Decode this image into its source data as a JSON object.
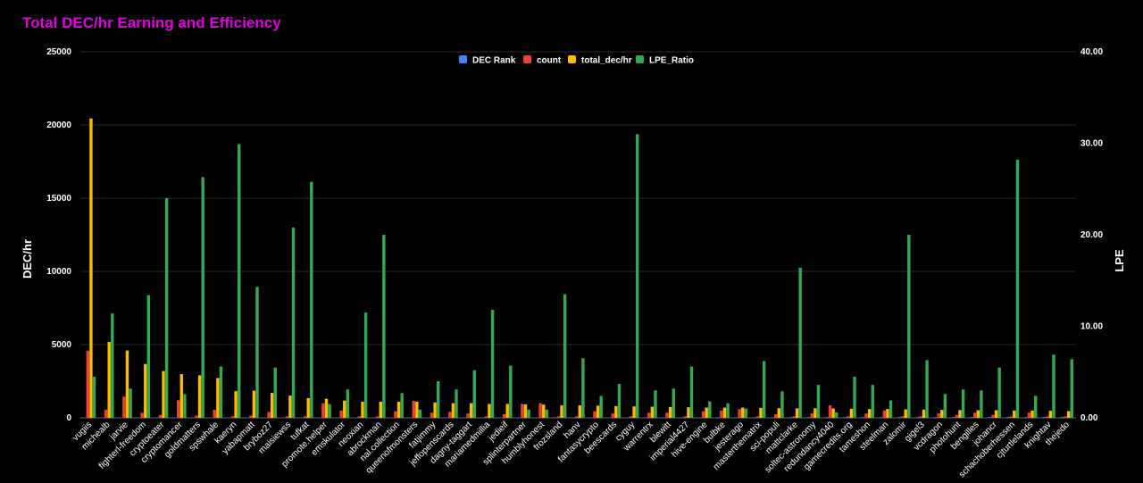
{
  "chart_data": {
    "type": "bar",
    "title": "Total DEC/hr Earning and Efficiency",
    "ylabel": "DEC/hr",
    "y2label": "LPE",
    "ylim": [
      0,
      25000
    ],
    "y2lim": [
      0,
      40
    ],
    "yticks": [
      "0",
      "5000",
      "10000",
      "15000",
      "20000",
      "25000"
    ],
    "y2ticks": [
      "0.00",
      "10.00",
      "20.00",
      "30.00",
      "40.00"
    ],
    "legend_position": "top-center",
    "colors": {
      "DEC Rank": "#4285f4",
      "count": "#ea4335",
      "total_dec/hr": "#fbbc04",
      "LPE_Ratio": "#34a853"
    },
    "categories": [
      "vugiis",
      "michealb",
      "jarvie",
      "fighterl-freedom",
      "cryptoeater",
      "cryptomancer",
      "goldmatters",
      "spswhale",
      "kaeryn",
      "yabapmatt",
      "bryboz27",
      "maisiewss",
      "tufkat",
      "promote.helper",
      "emskulator",
      "neoxian",
      "abrockman",
      "nal.collection",
      "queenofmonsters",
      "fatjimmy",
      "jeffopenscards",
      "dagny-taggart",
      "mariamedmillia",
      "jedieif",
      "splinterpartner",
      "humblyhonest",
      "frozsland",
      "hanv",
      "fantasycrypto",
      "beescards",
      "cyguy",
      "warrentrx",
      "blewitt",
      "imperial4427",
      "hive-engine",
      "bulbke",
      "jesterago",
      "masterthematrix",
      "sci-populi",
      "mattclarke",
      "soltec-astronomy",
      "redundancy4040",
      "gamecredits.org",
      "tameshon",
      "steelman",
      "zalomir",
      "gigel3",
      "vcdragon",
      "photohunt",
      "bengilles",
      "johancr",
      "schachoberhessen",
      "cjturtlelands",
      "knightav",
      "thejedo"
    ],
    "series": [
      {
        "name": "DEC Rank",
        "axis": "left",
        "values": [
          1,
          2,
          3,
          4,
          5,
          6,
          7,
          8,
          9,
          10,
          11,
          12,
          13,
          14,
          15,
          16,
          17,
          18,
          19,
          20,
          21,
          22,
          23,
          24,
          25,
          26,
          27,
          28,
          29,
          30,
          31,
          32,
          33,
          34,
          35,
          36,
          37,
          38,
          39,
          40,
          41,
          42,
          43,
          44,
          45,
          46,
          47,
          48,
          49,
          50,
          51,
          52,
          53,
          54,
          55
        ]
      },
      {
        "name": "count",
        "axis": "left",
        "values": [
          4580,
          550,
          1450,
          350,
          200,
          1200,
          150,
          550,
          100,
          150,
          400,
          100,
          100,
          1000,
          500,
          100,
          100,
          450,
          1150,
          350,
          400,
          300,
          100,
          250,
          950,
          1000,
          100,
          100,
          450,
          300,
          100,
          350,
          350,
          100,
          450,
          500,
          600,
          100,
          250,
          100,
          300,
          850,
          100,
          300,
          500,
          100,
          100,
          300,
          200,
          350,
          200,
          100,
          350,
          100,
          100
        ]
      },
      {
        "name": "total_dec/hr",
        "axis": "left",
        "values": [
          20450,
          5180,
          4600,
          3680,
          3200,
          2980,
          2900,
          2720,
          1820,
          1850,
          1700,
          1520,
          1350,
          1300,
          1180,
          1100,
          1100,
          1100,
          1100,
          1050,
          1000,
          1000,
          950,
          950,
          920,
          900,
          850,
          850,
          830,
          800,
          780,
          760,
          740,
          720,
          700,
          700,
          700,
          680,
          660,
          650,
          650,
          640,
          620,
          600,
          600,
          580,
          560,
          540,
          530,
          520,
          520,
          500,
          500,
          480,
          460
        ]
      },
      {
        "name": "LPE_Ratio",
        "axis": "right",
        "values": [
          4.5,
          11.4,
          3.2,
          13.4,
          24.0,
          2.6,
          26.3,
          5.6,
          29.9,
          14.3,
          5.5,
          20.8,
          25.8,
          1.5,
          3.1,
          11.5,
          20.0,
          2.7,
          0.9,
          4.0,
          3.1,
          5.2,
          11.8,
          5.7,
          0.9,
          0.9,
          13.5,
          6.5,
          2.4,
          3.7,
          31.0,
          3.0,
          3.2,
          5.6,
          1.8,
          1.6,
          1.0,
          6.2,
          2.9,
          16.4,
          3.6,
          0.6,
          4.5,
          3.6,
          1.9,
          20.0,
          6.3,
          2.6,
          3.1,
          3.0,
          5.5,
          28.2,
          2.4,
          6.9,
          6.4
        ]
      }
    ]
  }
}
